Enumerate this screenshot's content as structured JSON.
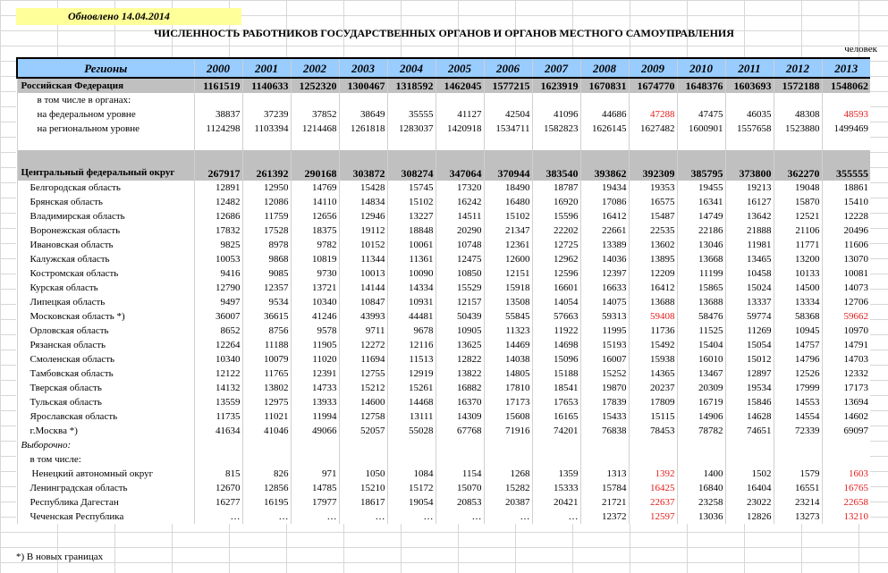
{
  "updated_label": "Обновлено  14.04.2014",
  "title": "ЧИСЛЕННОСТЬ РАБОТНИКОВ ГОСУДАРСТВЕННЫХ ОРГАНОВ И ОРГАНОВ МЕСТНОГО САМОУПРАВЛЕНИЯ",
  "unit": "человек",
  "header": {
    "region": "Регионы",
    "years": [
      "2000",
      "2001",
      "2002",
      "2003",
      "2004",
      "2005",
      "2006",
      "2007",
      "2008",
      "2009",
      "2010",
      "2011",
      "2012",
      "2013"
    ]
  },
  "rows": [
    {
      "label": "Российская Федерация",
      "style": "gray",
      "values": [
        "1161519",
        "1140633",
        "1252320",
        "1300467",
        "1318592",
        "1462045",
        "1577215",
        "1623919",
        "1670831",
        "1674770",
        "1648376",
        "1603693",
        "1572188",
        "1548062"
      ]
    },
    {
      "label": "в том числе в органах:",
      "style": "indent1",
      "values": [
        "",
        "",
        "",
        "",
        "",
        "",
        "",
        "",
        "",
        "",
        "",
        "",
        "",
        ""
      ]
    },
    {
      "label": "на федеральном уровне",
      "style": "indent1",
      "values": [
        "38837",
        "37239",
        "37852",
        "38649",
        "35555",
        "41127",
        "42504",
        "41096",
        "44686",
        "47288",
        "47475",
        "46035",
        "48308",
        "48593"
      ],
      "red": [
        9,
        13
      ]
    },
    {
      "label": "на региональном уровне",
      "style": "indent1",
      "values": [
        "1124298",
        "1103394",
        "1214468",
        "1261818",
        "1283037",
        "1420918",
        "1534711",
        "1582823",
        "1626145",
        "1627482",
        "1600901",
        "1557658",
        "1523880",
        "1499469"
      ]
    },
    {
      "label": "",
      "style": "blank",
      "values": [
        "",
        "",
        "",
        "",
        "",
        "",
        "",
        "",
        "",
        "",
        "",
        "",
        "",
        ""
      ]
    },
    {
      "label": "Центральный федеральный округ",
      "style": "gray-tall",
      "values": [
        "267917",
        "261392",
        "290168",
        "303872",
        "308274",
        "347064",
        "370944",
        "383540",
        "393862",
        "392309",
        "385795",
        "373800",
        "362270",
        "355555"
      ]
    },
    {
      "label": "Белгородская область",
      "style": "indent2",
      "values": [
        "12891",
        "12950",
        "14769",
        "15428",
        "15745",
        "17320",
        "18490",
        "18787",
        "19434",
        "19353",
        "19455",
        "19213",
        "19048",
        "18861"
      ]
    },
    {
      "label": "Брянская область",
      "style": "indent2",
      "values": [
        "12482",
        "12086",
        "14110",
        "14834",
        "15102",
        "16242",
        "16480",
        "16920",
        "17086",
        "16575",
        "16341",
        "16127",
        "15870",
        "15410"
      ]
    },
    {
      "label": "Владимирская область",
      "style": "indent2",
      "values": [
        "12686",
        "11759",
        "12656",
        "12946",
        "13227",
        "14511",
        "15102",
        "15596",
        "16412",
        "15487",
        "14749",
        "13642",
        "12521",
        "12228"
      ]
    },
    {
      "label": "Воронежская область",
      "style": "indent2",
      "values": [
        "17832",
        "17528",
        "18375",
        "19112",
        "18848",
        "20290",
        "21347",
        "22202",
        "22661",
        "22535",
        "22186",
        "21888",
        "21106",
        "20496"
      ]
    },
    {
      "label": "Ивановская область",
      "style": "indent2",
      "values": [
        "9825",
        "8978",
        "9782",
        "10152",
        "10061",
        "10748",
        "12361",
        "12725",
        "13389",
        "13602",
        "13046",
        "11981",
        "11771",
        "11606"
      ]
    },
    {
      "label": "Калужская область",
      "style": "indent2",
      "values": [
        "10053",
        "9868",
        "10819",
        "11344",
        "11361",
        "12475",
        "12600",
        "12962",
        "14036",
        "13895",
        "13668",
        "13465",
        "13200",
        "13070"
      ]
    },
    {
      "label": "Костромская область",
      "style": "indent2",
      "values": [
        "9416",
        "9085",
        "9730",
        "10013",
        "10090",
        "10850",
        "12151",
        "12596",
        "12397",
        "12209",
        "11199",
        "10458",
        "10133",
        "10081"
      ]
    },
    {
      "label": "Курская область",
      "style": "indent2",
      "values": [
        "12790",
        "12357",
        "13721",
        "14144",
        "14334",
        "15529",
        "15918",
        "16601",
        "16633",
        "16412",
        "15865",
        "15024",
        "14500",
        "14073"
      ]
    },
    {
      "label": "Липецкая область",
      "style": "indent2",
      "values": [
        "9497",
        "9534",
        "10340",
        "10847",
        "10931",
        "12157",
        "13508",
        "14054",
        "14075",
        "13688",
        "13688",
        "13337",
        "13334",
        "12706"
      ]
    },
    {
      "label": "Московская область *)",
      "style": "indent2",
      "values": [
        "36007",
        "36615",
        "41246",
        "43993",
        "44481",
        "50439",
        "55845",
        "57663",
        "59313",
        "59408",
        "58476",
        "59774",
        "58368",
        "59662"
      ],
      "red": [
        9,
        13
      ]
    },
    {
      "label": "Орловская область",
      "style": "indent2",
      "values": [
        "8652",
        "8756",
        "9578",
        "9711",
        "9678",
        "10905",
        "11323",
        "11922",
        "11995",
        "11736",
        "11525",
        "11269",
        "10945",
        "10970"
      ]
    },
    {
      "label": "Рязанская область",
      "style": "indent2",
      "values": [
        "12264",
        "11188",
        "11905",
        "12272",
        "12116",
        "13625",
        "14469",
        "14698",
        "15193",
        "15492",
        "15404",
        "15054",
        "14757",
        "14791"
      ]
    },
    {
      "label": "Смоленская область",
      "style": "indent2",
      "values": [
        "10340",
        "10079",
        "11020",
        "11694",
        "11513",
        "12822",
        "14038",
        "15096",
        "16007",
        "15938",
        "16010",
        "15012",
        "14796",
        "14703"
      ]
    },
    {
      "label": "Тамбовская область",
      "style": "indent2",
      "values": [
        "12122",
        "11765",
        "12391",
        "12755",
        "12919",
        "13822",
        "14805",
        "15188",
        "15252",
        "14365",
        "13467",
        "12897",
        "12526",
        "12332"
      ]
    },
    {
      "label": "Тверская область",
      "style": "indent2",
      "values": [
        "14132",
        "13802",
        "14733",
        "15212",
        "15261",
        "16882",
        "17810",
        "18541",
        "19870",
        "20237",
        "20309",
        "19534",
        "17999",
        "17173"
      ]
    },
    {
      "label": "Тульская область",
      "style": "indent2",
      "values": [
        "13559",
        "12975",
        "13933",
        "14600",
        "14468",
        "16370",
        "17173",
        "17653",
        "17839",
        "17809",
        "16719",
        "15846",
        "14553",
        "13694"
      ]
    },
    {
      "label": "Ярославская область",
      "style": "indent2",
      "values": [
        "11735",
        "11021",
        "11994",
        "12758",
        "13111",
        "14309",
        "15608",
        "16165",
        "15433",
        "15115",
        "14906",
        "14628",
        "14554",
        "14602"
      ]
    },
    {
      "label": "г.Москва *)",
      "style": "indent2",
      "values": [
        "41634",
        "41046",
        "49066",
        "52057",
        "55028",
        "67768",
        "71916",
        "74201",
        "76838",
        "78453",
        "78782",
        "74651",
        "72339",
        "69097"
      ]
    },
    {
      "label": "Выборочно:",
      "style": "italic",
      "values": [
        "",
        "",
        "",
        "",
        "",
        "",
        "",
        "",
        "",
        "",
        "",
        "",
        "",
        ""
      ]
    },
    {
      "label": "в том числе:",
      "style": "indent2",
      "values": [
        "",
        "",
        "",
        "",
        "",
        "",
        "",
        "",
        "",
        "",
        "",
        "",
        "",
        ""
      ]
    },
    {
      "label": "Ненецкий автономный округ",
      "style": "indent2b",
      "values": [
        "815",
        "826",
        "971",
        "1050",
        "1084",
        "1154",
        "1268",
        "1359",
        "1313",
        "1392",
        "1400",
        "1502",
        "1579",
        "1603"
      ],
      "red": [
        9,
        13
      ]
    },
    {
      "label": "Ленинградская область",
      "style": "indent2",
      "values": [
        "12670",
        "12856",
        "14785",
        "15210",
        "15172",
        "15070",
        "15282",
        "15333",
        "15784",
        "16425",
        "16840",
        "16404",
        "16551",
        "16765"
      ],
      "red": [
        9,
        13
      ]
    },
    {
      "label": "Республика Дагестан",
      "style": "indent2",
      "values": [
        "16277",
        "16195",
        "17977",
        "18617",
        "19054",
        "20853",
        "20387",
        "20421",
        "21721",
        "22637",
        "23258",
        "23022",
        "23214",
        "22658"
      ],
      "red": [
        9,
        13
      ]
    },
    {
      "label": "Чеченская Республика",
      "style": "indent2",
      "values": [
        "…",
        "…",
        "…",
        "…",
        "…",
        "…",
        "…",
        "…",
        "12372",
        "12597",
        "13036",
        "12826",
        "13273",
        "13210"
      ],
      "red": [
        9,
        13
      ]
    }
  ],
  "footnote": "*) В новых границах"
}
